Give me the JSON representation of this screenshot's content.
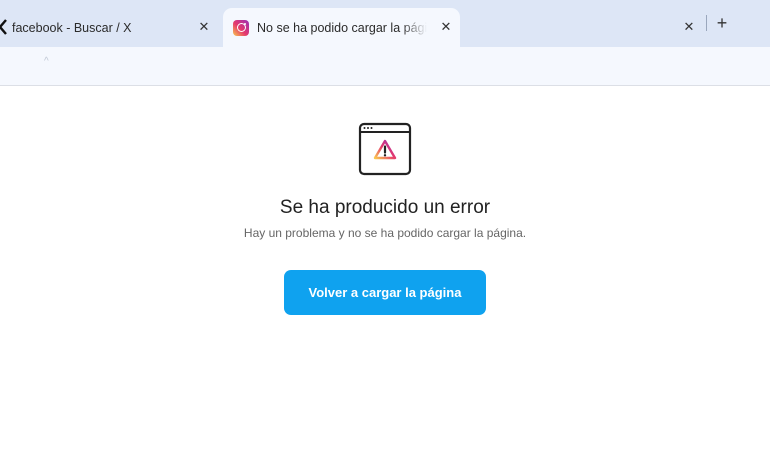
{
  "tabs": [
    {
      "label": "facebook - Buscar / X",
      "favicon": "x-logo-icon",
      "active": false
    },
    {
      "label": "No se ha podido cargar la página",
      "favicon": "instagram-icon",
      "active": true
    },
    {
      "label": "",
      "favicon": "",
      "active": false
    }
  ],
  "tabstrip": {
    "close_glyph": "✕",
    "new_tab_glyph": "+"
  },
  "toolbar": {
    "mark": "^"
  },
  "error": {
    "icon": "browser-window-warning-icon",
    "title": "Se ha producido un error",
    "subtitle": "Hay un problema y no se ha podido cargar la página.",
    "button_label": "Volver a cargar la página"
  },
  "colors": {
    "tabstrip_bg": "#dde6f6",
    "active_tab_bg": "#f5f8fe",
    "button_bg": "#0fa2ef",
    "warning_gradient": [
      "#f9c74f",
      "#e5396c",
      "#9b2fb8"
    ]
  }
}
